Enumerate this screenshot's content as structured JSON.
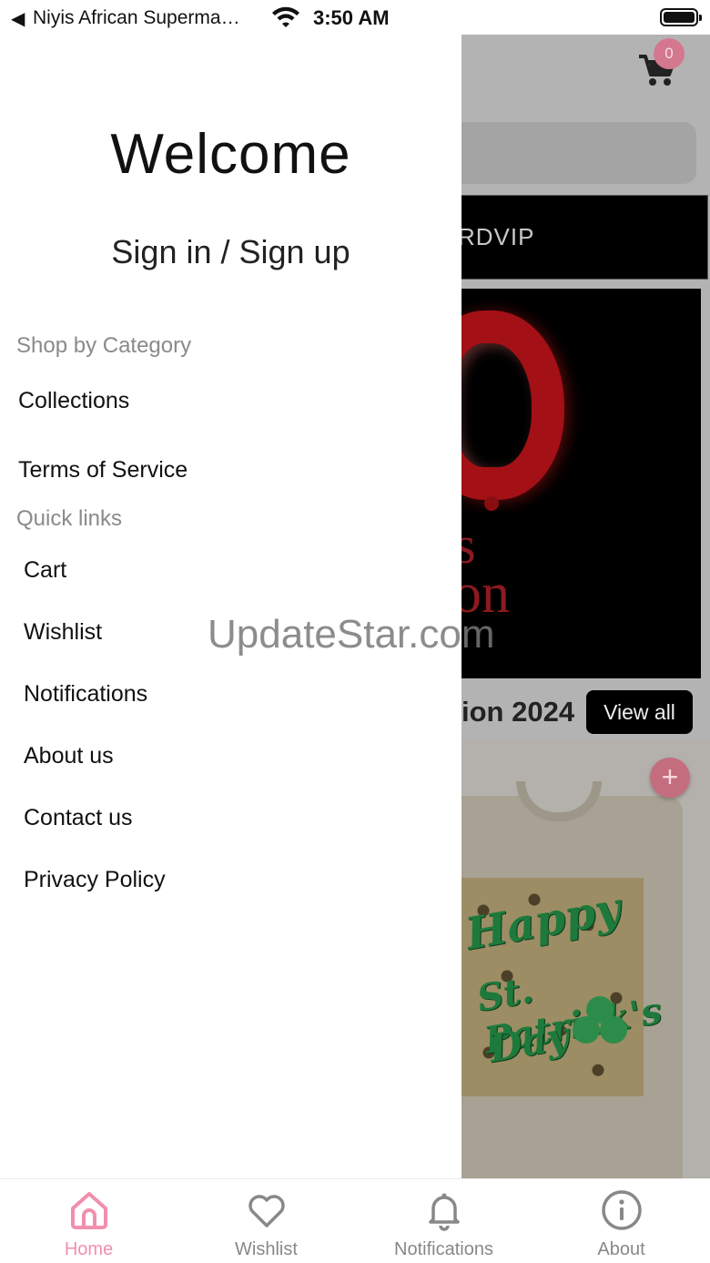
{
  "status_bar": {
    "back_glyph": "◀",
    "app_name": "Niyis African Superma…",
    "time": "3:50 AM"
  },
  "background_app": {
    "cart_badge_count": "0",
    "promo_banner_text": "RDVIP",
    "section_title": "ion 2024",
    "view_all_label": "View all",
    "add_button_glyph": "+",
    "tshirt_line1": "Happy",
    "tshirt_line2": "St. Patrick's",
    "tshirt_line3": "Day"
  },
  "drawer": {
    "welcome_title": "Welcome",
    "sign_in_label": "Sign in / Sign up",
    "shop_section_label": "Shop by Category",
    "shop_items": [
      "Collections",
      "Terms of Service"
    ],
    "quick_links_label": "Quick links",
    "quick_links": [
      "Cart",
      "Wishlist",
      "Notifications",
      "About us",
      "Contact us",
      "Privacy Policy"
    ]
  },
  "watermark": "UpdateStar.com",
  "tabbar": {
    "tabs": [
      {
        "label": "Home",
        "icon": "home-icon",
        "active": true
      },
      {
        "label": "Wishlist",
        "icon": "heart-icon",
        "active": false
      },
      {
        "label": "Notifications",
        "icon": "bell-icon",
        "active": false
      },
      {
        "label": "About",
        "icon": "info-icon",
        "active": false
      }
    ]
  },
  "colors": {
    "accent_pink": "#f18fad",
    "badge_pink": "#d4788f",
    "overlay_gray": "#b3b3b3",
    "inactive_gray": "#888888"
  }
}
